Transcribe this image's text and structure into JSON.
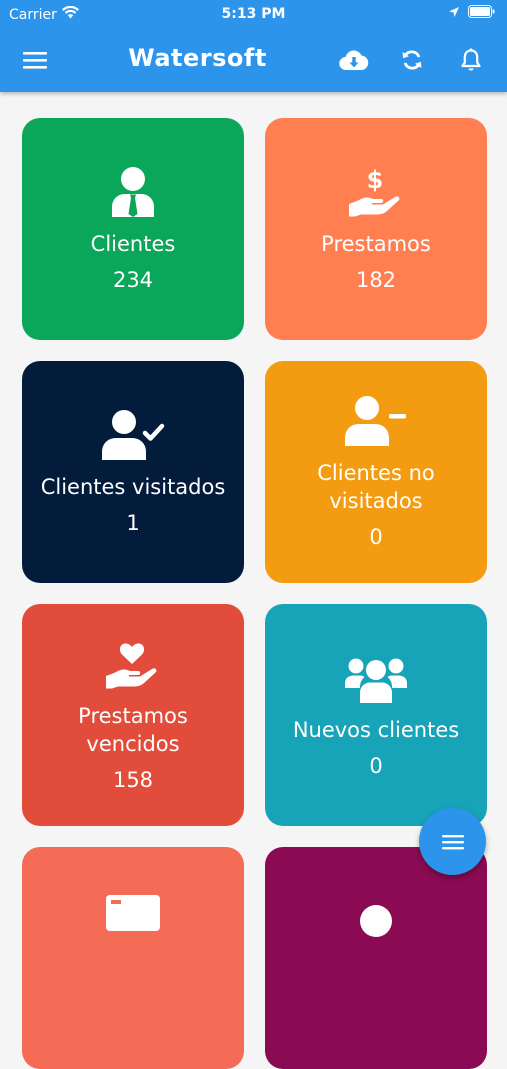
{
  "status_bar": {
    "carrier": "Carrier",
    "time": "5:13 PM",
    "icons": [
      "wifi-icon",
      "location-arrow-icon",
      "battery-icon"
    ]
  },
  "app_bar": {
    "title": "Watersoft",
    "background_color": "#2c95eb",
    "icons": [
      "menu-icon",
      "cloud-download-icon",
      "sync-icon",
      "bell-icon"
    ]
  },
  "cards": [
    {
      "label": "Clientes",
      "count": "234",
      "color": "#0aa659",
      "icon": "user-tie-icon"
    },
    {
      "label": "Prestamos",
      "count": "182",
      "color": "#ff7f50",
      "icon": "hand-dollar-icon"
    },
    {
      "label": "Clientes visitados",
      "count": "1",
      "color": "#041c3c",
      "icon": "user-check-icon"
    },
    {
      "label": "Clientes no visitados",
      "count": "0",
      "color": "#f39c12",
      "icon": "user-minus-icon"
    },
    {
      "label": "Prestamos vencidos",
      "count": "158",
      "color": "#e24c3b",
      "icon": "hand-heart-icon"
    },
    {
      "label": "Nuevos clientes",
      "count": "0",
      "color": "#17a3b8",
      "icon": "users-icon"
    },
    {
      "color": "#f46c56",
      "icon": "card-icon"
    },
    {
      "color": "#8a0b53",
      "icon": "circle-icon"
    }
  ],
  "fab": {
    "icon": "menu-icon",
    "color": "#2c95eb"
  }
}
